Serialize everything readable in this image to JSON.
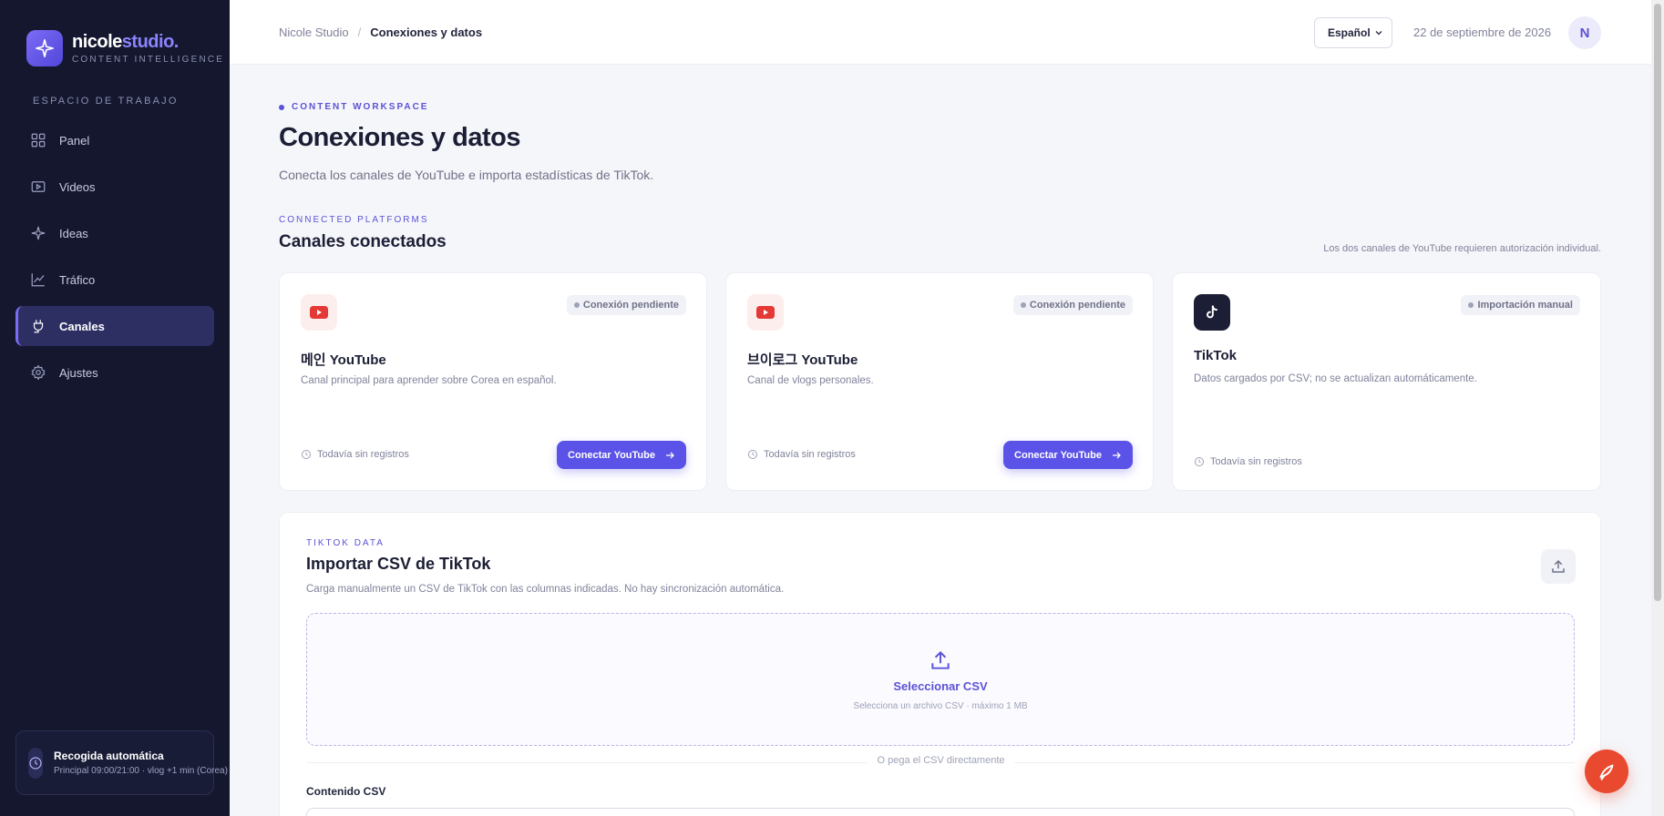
{
  "sidebar": {
    "brand": {
      "name_part1": "nicole",
      "name_part2": "studio.",
      "tagline": "CONTENT INTELLIGENCE"
    },
    "section_label": "ESPACIO DE TRABAJO",
    "items": [
      {
        "label": "Panel",
        "icon": "grid-icon",
        "active": false
      },
      {
        "label": "Videos",
        "icon": "video-icon",
        "active": false
      },
      {
        "label": "Ideas",
        "icon": "sparkle-icon",
        "active": false
      },
      {
        "label": "Tráfico",
        "icon": "chart-icon",
        "active": false
      },
      {
        "label": "Canales",
        "icon": "plug-icon",
        "active": true
      },
      {
        "label": "Ajustes",
        "icon": "gear-icon",
        "active": false
      }
    ],
    "auto_collect": {
      "title": "Recogida automática",
      "subtitle": "Principal 09:00/21:00 · vlog +1 min (Corea)"
    }
  },
  "header": {
    "breadcrumb": {
      "root": "Nicole Studio",
      "separator": "/",
      "current": "Conexiones y datos"
    },
    "language": "Español",
    "date": "22 de septiembre de 2026",
    "avatar_initial": "N"
  },
  "main": {
    "eyebrow": "CONTENT WORKSPACE",
    "title": "Conexiones y datos",
    "subtitle": "Conecta los canales de YouTube e importa estadísticas de TikTok.",
    "platforms": {
      "eyebrow": "CONNECTED PLATFORMS",
      "title": "Canales conectados",
      "note": "Los dos canales de YouTube requieren autorización individual.",
      "cards": [
        {
          "title": "메인 YouTube",
          "badge": "Conexión pendiente",
          "desc": "Canal principal para aprender sobre Corea en español.",
          "footer": "Todavía sin registros",
          "button": "Conectar YouTube",
          "icon": "youtube-icon"
        },
        {
          "title": "브이로그 YouTube",
          "badge": "Conexión pendiente",
          "desc": "Canal de vlogs personales.",
          "footer": "Todavía sin registros",
          "button": "Conectar YouTube",
          "icon": "youtube-icon"
        },
        {
          "title": "TikTok",
          "badge": "Importación manual",
          "desc": "Datos cargados por CSV; no se actualizan automáticamente.",
          "footer": "Todavía sin registros",
          "icon": "tiktok-icon"
        }
      ]
    },
    "import": {
      "eyebrow": "TIKTOK DATA",
      "title": "Importar CSV de TikTok",
      "desc": "Carga manualmente un CSV de TikTok con las columnas indicadas. No hay sincronización automática.",
      "drop_title": "Seleccionar CSV",
      "drop_sub": "Selecciona un archivo CSV · máximo 1 MB",
      "divider": "O pega el CSV directamente",
      "csv_label": "Contenido CSV"
    }
  },
  "colors": {
    "accent": "#5b53e8",
    "sidebar_bg": "#14172e",
    "youtube_red": "#e53935",
    "fab": "#e8492f"
  }
}
